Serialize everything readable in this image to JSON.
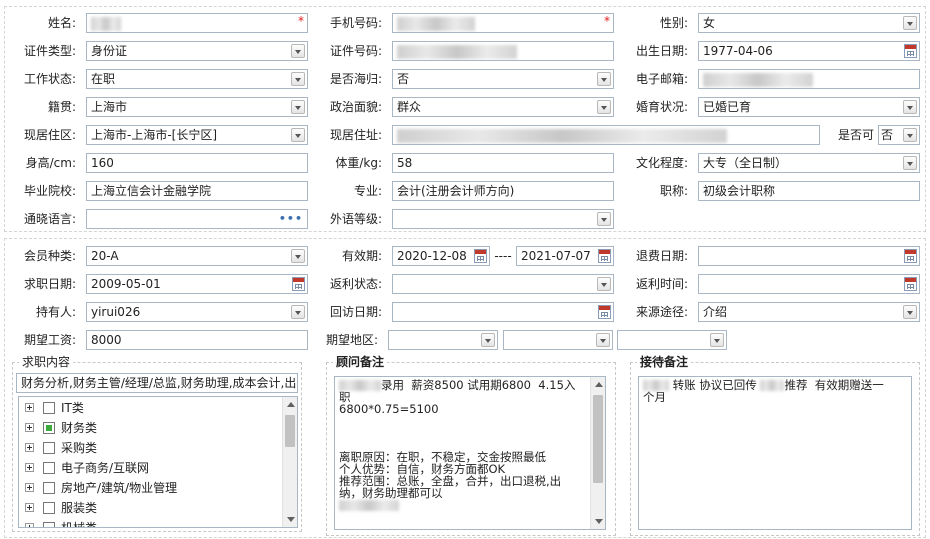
{
  "basic": {
    "name_label": "姓名:",
    "phone_label": "手机号码:",
    "gender_label": "性别:",
    "gender_value": "女",
    "id_type_label": "证件类型:",
    "id_type_value": "身份证",
    "id_no_label": "证件号码:",
    "birth_label": "出生日期:",
    "birth_value": "1977-04-06",
    "work_status_label": "工作状态:",
    "work_status_value": "在职",
    "returnee_label": "是否海归:",
    "returnee_value": "否",
    "email_label": "电子邮箱:",
    "native_label": "籍贯:",
    "native_value": "上海市",
    "political_label": "政治面貌:",
    "political_value": "群众",
    "marital_label": "婚育状况:",
    "marital_value": "已婚已育",
    "residence_area_label": "现居住区:",
    "residence_area_value": "上海市-上海市-[长宁区]",
    "address_label": "现居住址:",
    "allow_label": "是否可",
    "allow_value": "否",
    "height_label": "身高/cm:",
    "height_value": "160",
    "weight_label": "体重/kg:",
    "weight_value": "58",
    "education_label": "文化程度:",
    "education_value": "大专（全日制）",
    "school_label": "毕业院校:",
    "school_value": "上海立信会计金融学院",
    "major_label": "专业:",
    "major_value": "会计(注册会计师方向)",
    "title_label": "职称:",
    "title_value": "初级会计职称",
    "language_label": "通晓语言:",
    "foreign_level_label": "外语等级:"
  },
  "member": {
    "type_label": "会员种类:",
    "type_value": "20-A",
    "valid_label": "有效期:",
    "valid_from": "2020-12-08",
    "valid_sep": "----",
    "valid_to": "2021-07-07",
    "refund_label": "退费日期:",
    "apply_date_label": "求职日期:",
    "apply_date_value": "2009-05-01",
    "rebate_status_label": "返利状态:",
    "rebate_time_label": "返利时间:",
    "holder_label": "持有人:",
    "holder_value": "yirui026",
    "visit_date_label": "回访日期:",
    "source_label": "来源途径:",
    "source_value": "介绍",
    "salary_label": "期望工资:",
    "salary_value": "8000",
    "region_label": "期望地区:"
  },
  "job": {
    "legend": "求职内容",
    "summary": "财务分析,财务主管/经理/总监,财务助理,成本会计,出",
    "tree": [
      "IT类",
      "财务类",
      "采购类",
      "电子商务/互联网",
      "房地产/建筑/物业管理",
      "服装类",
      "机械类"
    ]
  },
  "consultant": {
    "legend": "顾问备注",
    "lines": [
      "录用  薪资8500 试用期6800  4.15入",
      "职",
      "6800*0.75=5100",
      "",
      "",
      "",
      "离职原因：在职，不稳定，交金按照最低",
      "个人优势：自信，财务方面都OK",
      "推荐范围：总账，全盘，合并，出口退税,出",
      "纳，财务助理都可以"
    ]
  },
  "reception": {
    "legend": "接待备注",
    "line1_a": "转账 协议已回传",
    "line1_b": "推荐  有效期赠送一",
    "line2": "个月"
  },
  "colors": {
    "border": "#a9b6c4",
    "required": "#e02020",
    "tree_check": "#3cab3c"
  }
}
